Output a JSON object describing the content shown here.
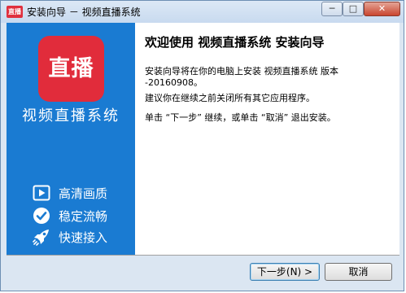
{
  "window": {
    "title": "安装向导 － 视频直播系统",
    "app_icon_text": "直播",
    "minimize_label": "─",
    "maximize_label": "□",
    "close_label": "✕"
  },
  "sidebar": {
    "logo_text": "直播",
    "product_name": "视频直播系统",
    "accent_color": "#1a7bd2",
    "logo_color": "#e12c3b",
    "features": [
      {
        "label": "高清画质",
        "icon": "play-icon"
      },
      {
        "label": "稳定流畅",
        "icon": "check-circle-icon"
      },
      {
        "label": "快速接入",
        "icon": "rocket-icon"
      }
    ]
  },
  "content": {
    "heading": "欢迎使用 视频直播系统 安装向导",
    "paragraph1": "安装向导将在你的电脑上安装 视频直播系统 版本 -20160908。",
    "paragraph2": "建议你在继续之前关闭所有其它应用程序。",
    "paragraph3": "单击 “下一步” 继续，或单击 “取消” 退出安装。"
  },
  "buttons": {
    "next_label": "下一步(N) >",
    "cancel_label": "取消"
  }
}
